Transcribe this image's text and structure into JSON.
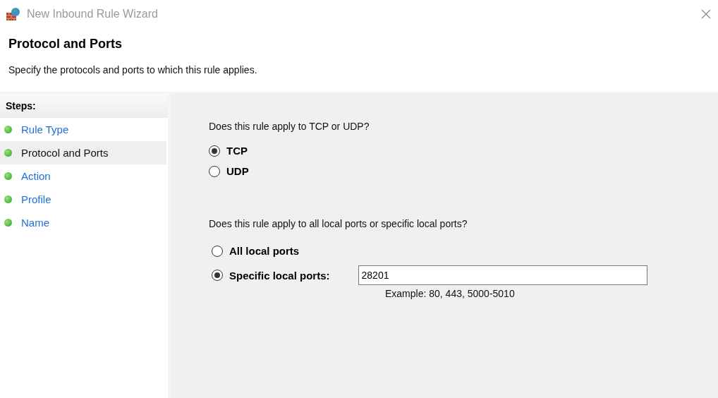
{
  "window": {
    "title": "New Inbound Rule Wizard"
  },
  "header": {
    "title": "Protocol and Ports",
    "subtitle": "Specify the protocols and ports to which this rule applies."
  },
  "steps": {
    "heading": "Steps:",
    "items": [
      {
        "label": "Rule Type",
        "selected": false
      },
      {
        "label": "Protocol and Ports",
        "selected": true
      },
      {
        "label": "Action",
        "selected": false
      },
      {
        "label": "Profile",
        "selected": false
      },
      {
        "label": "Name",
        "selected": false
      }
    ]
  },
  "protocol": {
    "question": "Does this rule apply to TCP or UDP?",
    "options": [
      {
        "label": "TCP",
        "selected": true
      },
      {
        "label": "UDP",
        "selected": false
      }
    ]
  },
  "ports": {
    "question": "Does this rule apply to all local ports or specific local ports?",
    "options": [
      {
        "label": "All local ports",
        "selected": false,
        "kind": "plain"
      },
      {
        "label": "Specific local ports:",
        "selected": true,
        "kind": "input",
        "value": "28201",
        "hint": "Example: 80, 443, 5000-5010"
      }
    ]
  }
}
